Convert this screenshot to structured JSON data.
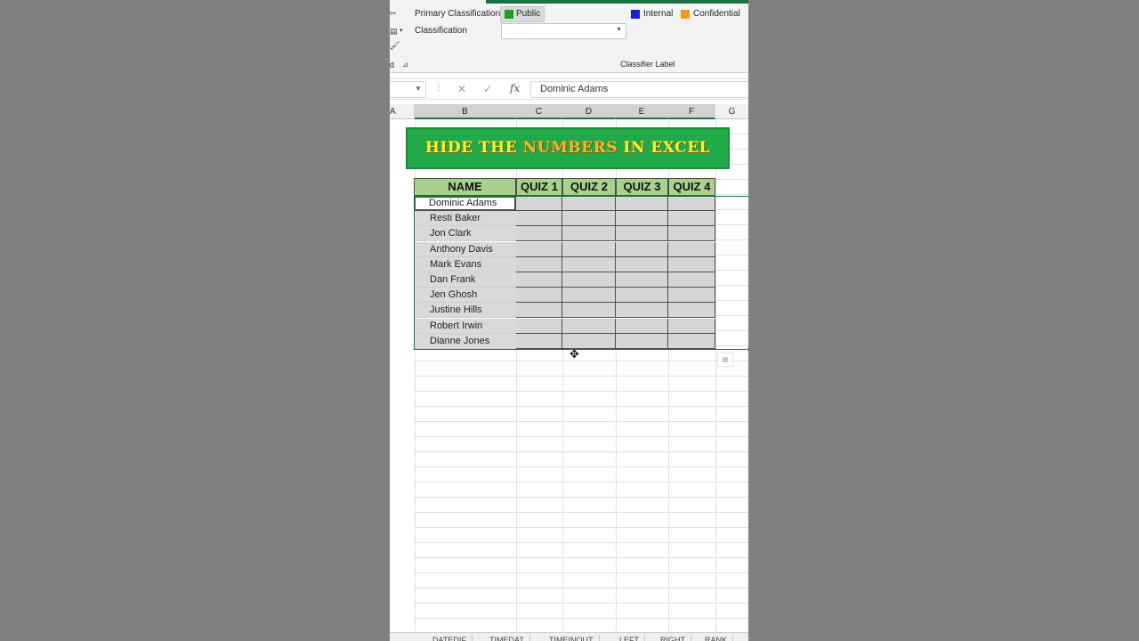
{
  "ribbon": {
    "primary_classification_label": "Primary Classification",
    "public_label": "Public",
    "internal_label": "Internal",
    "confidential_label": "Confidential",
    "classification_label": "Classification",
    "group_label": "Classifier Label",
    "truncated_char": "d",
    "colors": {
      "public": "#1aa01a",
      "internal": "#1a1adb",
      "confidential": "#f39a1b"
    }
  },
  "formula_bar": {
    "cancel_glyph": "✕",
    "enter_glyph": "✓",
    "fx_label": "fx",
    "value": "Dominic Adams"
  },
  "columns": [
    "A",
    "B",
    "C",
    "D",
    "E",
    "F",
    "G"
  ],
  "banner": {
    "part1": "HIDE THE ",
    "highlight": "NUMBERS",
    "part2": " IN EXCEL"
  },
  "table": {
    "headers": [
      "NAME",
      "QUIZ 1",
      "QUIZ 2",
      "QUIZ 3",
      "QUIZ 4"
    ],
    "rows": [
      "Dominic Adams",
      "Resti Baker",
      "Jon Clark",
      "Anthony Davis",
      "Mark Evans",
      "Dan Frank",
      "Jen Ghosh",
      "Justine Hills",
      "Robert Irwin",
      "Dianne Jones"
    ]
  },
  "sheet_tabs": [
    "DATEDIF",
    "TIMEDAT",
    "TIMEINOUT",
    "LEFT",
    "RIGHT",
    "RANK"
  ],
  "accent_color": "#217346",
  "header_fill": "#a9d18e"
}
